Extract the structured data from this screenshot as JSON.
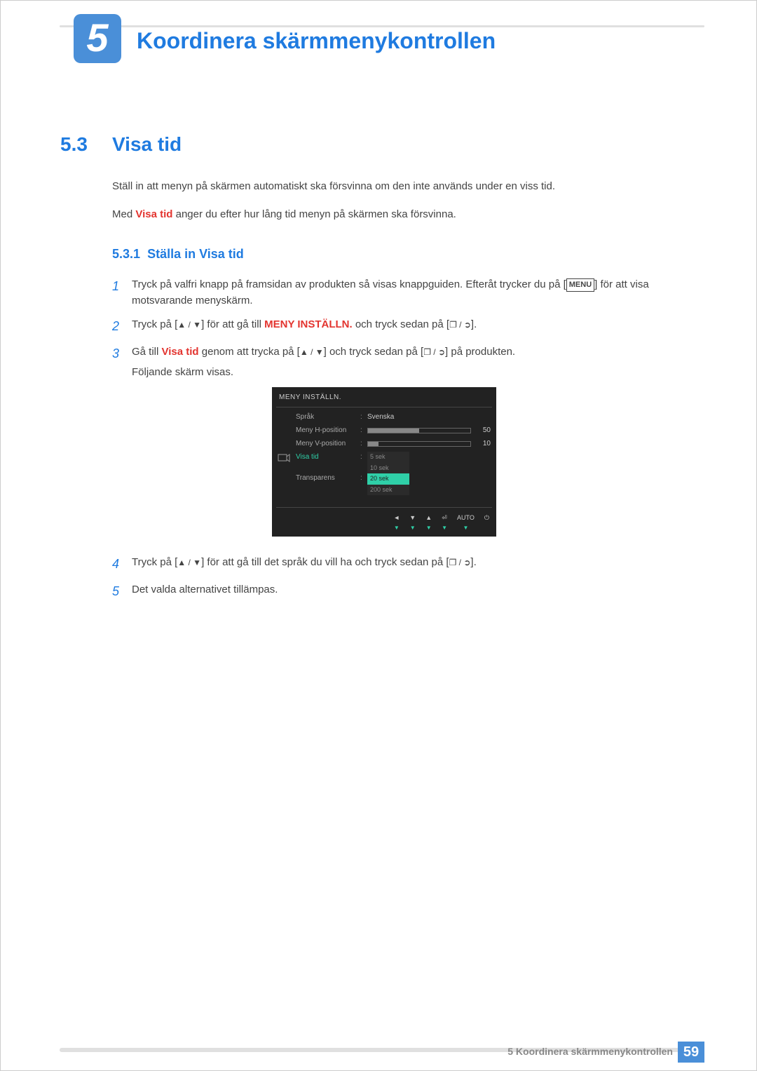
{
  "chapter": {
    "number": "5",
    "title": "Koordinera skärmmenykontrollen"
  },
  "section": {
    "number": "5.3",
    "title": "Visa tid"
  },
  "intro": {
    "p1": "Ställ in att menyn på skärmen automatiskt ska försvinna om den inte används under en viss tid.",
    "p2_pre": "Med ",
    "p2_red": "Visa tid",
    "p2_post": " anger du efter hur lång tid menyn på skärmen ska försvinna."
  },
  "subsection": {
    "number": "5.3.1",
    "title": "Ställa in Visa tid"
  },
  "steps": {
    "s1": {
      "n": "1",
      "pre": "Tryck på valfri knapp på framsidan av produkten så visas knappguiden. Efteråt trycker du på [",
      "menu": "MENU",
      "post": "] för att visa motsvarande menyskärm."
    },
    "s2": {
      "n": "2",
      "pre": "Tryck på [",
      "mid": "] för att gå till ",
      "bold": "MENY INSTÄLLN.",
      "post": " och tryck sedan på [",
      "end": "]."
    },
    "s3": {
      "n": "3",
      "pre": "Gå till ",
      "red": "Visa tid",
      "mid1": " genom att trycka på [",
      "mid2": "] och tryck sedan på [",
      "post": "] på produkten.",
      "line2": "Följande skärm visas."
    },
    "s4": {
      "n": "4",
      "pre": "Tryck på [",
      "mid": "] för att gå till det språk du vill ha och tryck sedan på [",
      "end": "]."
    },
    "s5": {
      "n": "5",
      "text": "Det valda alternativet tillämpas."
    }
  },
  "osd": {
    "title": "MENY INSTÄLLN.",
    "rows": {
      "language": {
        "label": "Språk",
        "value": "Svenska"
      },
      "hpos": {
        "label": "Meny H-position",
        "value": "50",
        "fill": 50
      },
      "vpos": {
        "label": "Meny V-position",
        "value": "10",
        "fill": 10
      },
      "visatid": {
        "label": "Visa tid",
        "options": [
          "5 sek",
          "10 sek",
          "20 sek",
          "200 sek"
        ],
        "selected": 2
      },
      "transparens": {
        "label": "Transparens"
      }
    },
    "nav": {
      "left": "◄",
      "down": "▼",
      "up": "▲",
      "enter": "⏎",
      "auto": "AUTO",
      "power": "⏻"
    }
  },
  "footer": {
    "text": "5 Koordinera skärmmenykontrollen",
    "page": "59"
  }
}
